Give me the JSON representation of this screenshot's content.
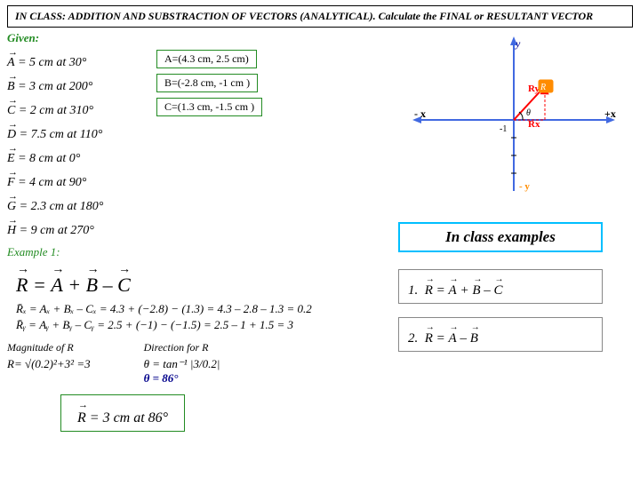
{
  "header": {
    "text": "IN CLASS: ADDITION AND SUBSTRACTION OF VECTORS (ANALYTICAL).  Calculate the FINAL or RESULTANT VECTOR"
  },
  "given": {
    "label": "Given:",
    "vectors": [
      {
        "symbol": "A⃗",
        "value": "= 5 cm at 30°",
        "box": "A=(4.3 cm,  2.5 cm)"
      },
      {
        "symbol": "B⃗",
        "value": "= 3 cm at 200°",
        "box": "B=(-2.8 cm, -1 cm )"
      },
      {
        "symbol": "C⃗",
        "value": "= 2 cm at 310°",
        "box": "C=(1.3 cm, -1.5 cm )"
      },
      {
        "symbol": "D⃗",
        "value": "= 7.5 cm at 110°"
      },
      {
        "symbol": "E⃗",
        "value": "= 8 cm at 0°"
      },
      {
        "symbol": "F⃗",
        "value": "= 4 cm at 90°"
      },
      {
        "symbol": "G⃗",
        "value": "= 2.3 cm at 180°"
      },
      {
        "symbol": "H⃗",
        "value": "= 9 cm at 270°"
      }
    ]
  },
  "example1": {
    "label": "Example 1:",
    "formula": "R⃗ = A⃗ + B⃗ – C⃗",
    "rx_line": "R̄ₓ = Aₓ + Bₓ – Cₓ = 4.3 + (−2.8) − (1.3) = 4.3 – 2.8 – 1.3 = 0.2",
    "ry_line": "R̄ᵧ = Aᵧ + Bᵧ – Cᵧ = 2.5 + (−1) − (−1.5) = 2.5 – 1 + 1.5 = 3",
    "magnitude_label": "Magnitude of R",
    "magnitude_val": "R= √(0.2)²+3² =3",
    "direction_label": "Direction for R",
    "direction_val": "θ = tan⁻¹ |3/0.2|",
    "direction_result": "θ = 86°",
    "result": "R⃗ = 3 cm at 86°"
  },
  "right_panel": {
    "in_class_label": "In class examples",
    "ex1_label": "1. R⃗ = A⃗ + B⃗ – C⃗",
    "ex2_label": "2. R⃗ = A⃗ – B⃗",
    "coord": {
      "rx_label": "Rx",
      "ry_label": "Ry",
      "minus_x": "- x",
      "plus_x": "+x",
      "minus_y": "- y",
      "minus1": "-1",
      "theta": "θ"
    }
  }
}
